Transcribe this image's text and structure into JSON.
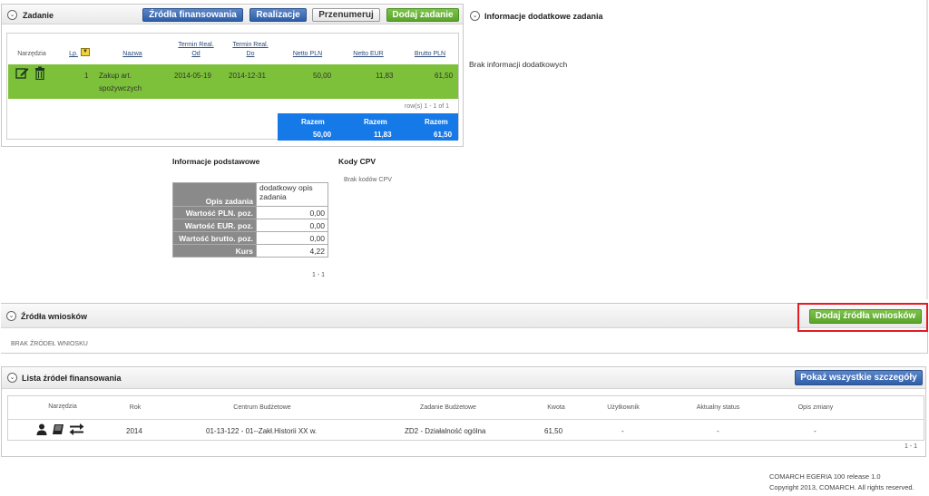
{
  "zadanie": {
    "title": "Zadanie",
    "buttons": {
      "zrodla_finansowania": "Źródła finansowania",
      "realizacje": "Realizacje",
      "przenumeruj": "Przenumeruj",
      "dodaj_zadanie": "Dodaj zadanie"
    },
    "columns": {
      "narzedzia": "Narzędzia",
      "lp": "Lp.",
      "nazwa": "Nazwa",
      "termin_od_1": "Termin Real.",
      "termin_od_2": "Od",
      "termin_do_1": "Termin Real.",
      "termin_do_2": "Do",
      "netto_pln": "Netto PLN",
      "netto_eur": "Netto EUR",
      "brutto_pln": "Brutto PLN"
    },
    "row": {
      "lp": "1",
      "nazwa_1": "Zakup art.",
      "nazwa_2": "spożywczych",
      "od": "2014-05-19",
      "do": "2014-12-31",
      "netto_pln": "50,00",
      "netto_eur": "11,83",
      "brutto_pln": "61,50"
    },
    "rows_info": "row(s) 1 - 1 of 1",
    "totals": {
      "label": "Razem",
      "netto_pln": "50,00",
      "netto_eur": "11,83",
      "brutto_pln": "61,50"
    }
  },
  "info_dodatkowe": {
    "title": "Informacje dodatkowe zadania",
    "empty": "Brak informacji dodatkowych"
  },
  "info_podstawowe": {
    "title": "Informacje podstawowe",
    "rows": [
      {
        "key": "Opis zadania",
        "value": "dodatkowy opis zadania"
      },
      {
        "key": "Wartość PLN. poz.",
        "value": "0,00"
      },
      {
        "key": "Wartość EUR. poz.",
        "value": "0,00"
      },
      {
        "key": "Wartość brutto. poz.",
        "value": "0,00"
      },
      {
        "key": "Kurs",
        "value": "4,22"
      }
    ],
    "pager": "1 - 1"
  },
  "kody_cpv": {
    "title": "Kody CPV",
    "empty": "Brak kodów CPV"
  },
  "zrodla_wnioskow": {
    "title": "Źródła wniosków",
    "button": "Dodaj źródła wniosków",
    "empty": "BRAK ŹRÓDEŁ WNIOSKU"
  },
  "lista_zrodel": {
    "title": "Lista źródeł finansowania",
    "button": "Pokaż wszystkie szczegóły",
    "columns": {
      "narzedzia": "Narzędzia",
      "rok": "Rok",
      "centrum": "Centrum Budżetowe",
      "zadanie": "Zadanie Budżetowe",
      "kwota": "Kwota",
      "uzytkownik": "Użytkownik",
      "status": "Aktualny status",
      "opis": "Opis zmiany"
    },
    "row": {
      "rok": "2014",
      "centrum": "01-13-122 - 01--Zakł.Historii XX w.",
      "zadanie": "ZD2 - Działalność ogólna",
      "kwota": "61,50",
      "uzytkownik": "-",
      "status": "-",
      "opis": "-"
    },
    "pager": "1 - 1"
  },
  "footer": {
    "line1": "COMARCH EGERIA 100 release 1.0",
    "line2": "Copyright 2013, COMARCH. All rights reserved."
  },
  "colors": {
    "green_row": "#7dc13a",
    "blue_totals": "#1679e8",
    "highlight": "#e31b23"
  }
}
